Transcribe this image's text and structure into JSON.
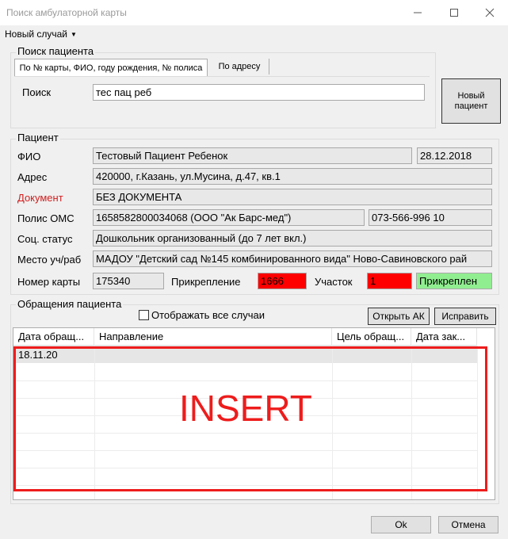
{
  "window": {
    "title": "Поиск амбулаторной карты"
  },
  "menu": {
    "new_case": "Новый случай"
  },
  "search": {
    "group_title": "Поиск пациента",
    "tabs": [
      "По № карты, ФИО, году рождения, № полиса",
      "По адресу"
    ],
    "label": "Поиск",
    "value": "тес пац реб",
    "new_patient_label": "Новый\nпациент"
  },
  "patient": {
    "group_title": "Пациент",
    "labels": {
      "fio": "ФИО",
      "address": "Адрес",
      "document": "Документ",
      "policy": "Полис ОМС",
      "social": "Соц. статус",
      "work": "Место уч/раб",
      "card": "Номер карты",
      "attachment": "Прикрепление",
      "district": "Участок"
    },
    "values": {
      "fio": "Тестовый Пациент Ребенок",
      "birthdate": "28.12.2018",
      "address": "420000, г.Казань, ул.Мусина, д.47, кв.1",
      "document": "БЕЗ ДОКУМЕНТА",
      "policy": "1658582800034068 (ООО \"Ак Барс-мед\")",
      "policy_phone": "073-566-996 10",
      "social": "Дошкольник организованный (до 7 лет вкл.)",
      "work": "МАДОУ \"Детский сад №145 комбинированного вида\" Ново-Савиновского рай",
      "card": "175340",
      "attachment": "1666",
      "district": "1",
      "attach_status": "Прикреплен"
    },
    "colors": {
      "document_label": "#d21e1e",
      "red_field": "#ff0000",
      "green_field": "#90ee90"
    }
  },
  "visits": {
    "group_title": "Обращения пациента",
    "show_all_label": "Отображать все случаи",
    "open_ak_label": "Открыть АК",
    "fix_label": "Исправить",
    "columns": [
      "Дата обращ...",
      "Направление",
      "Цель обращ...",
      "Дата зак..."
    ],
    "rows": [
      [
        "18.11.20",
        "",
        "",
        ""
      ]
    ]
  },
  "overlay": {
    "text": "INSERT",
    "color": "#ee1c1c"
  },
  "footer": {
    "ok": "Ok",
    "cancel": "Отмена"
  }
}
